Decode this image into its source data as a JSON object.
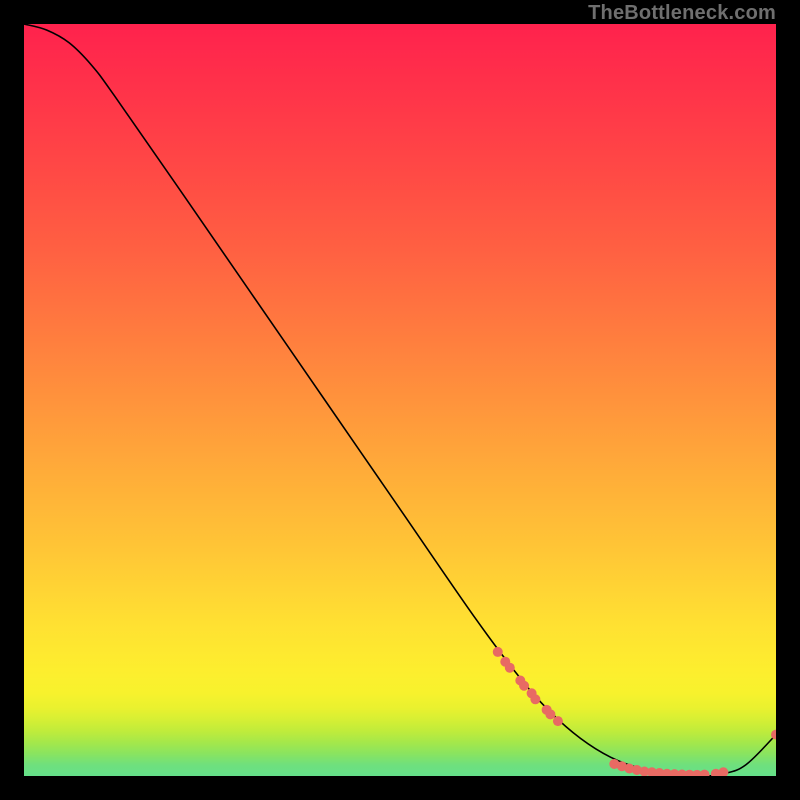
{
  "watermark": "TheBottleneck.com",
  "chart_data": {
    "type": "line",
    "title": "",
    "xlabel": "",
    "ylabel": "",
    "xlim": [
      0,
      100
    ],
    "ylim": [
      0,
      100
    ],
    "grid": false,
    "legend": false,
    "gradient_bands": [
      {
        "pos": 0.0,
        "color": "#65e08a"
      },
      {
        "pos": 0.015,
        "color": "#6fe07d"
      },
      {
        "pos": 0.03,
        "color": "#8ae45f"
      },
      {
        "pos": 0.045,
        "color": "#a5e84a"
      },
      {
        "pos": 0.06,
        "color": "#c0ec3b"
      },
      {
        "pos": 0.075,
        "color": "#d6ef34"
      },
      {
        "pos": 0.09,
        "color": "#e9f12f"
      },
      {
        "pos": 0.11,
        "color": "#f7f22d"
      },
      {
        "pos": 0.14,
        "color": "#fdee2e"
      },
      {
        "pos": 0.2,
        "color": "#ffe132"
      },
      {
        "pos": 0.3,
        "color": "#ffc636"
      },
      {
        "pos": 0.4,
        "color": "#ffad39"
      },
      {
        "pos": 0.5,
        "color": "#ff933c"
      },
      {
        "pos": 0.6,
        "color": "#ff793f"
      },
      {
        "pos": 0.7,
        "color": "#ff6042"
      },
      {
        "pos": 0.8,
        "color": "#ff4a45"
      },
      {
        "pos": 0.9,
        "color": "#ff3549"
      },
      {
        "pos": 1.0,
        "color": "#ff224d"
      }
    ],
    "series": [
      {
        "name": "bottleneck-curve",
        "x": [
          0,
          3,
          6,
          9,
          12,
          20,
          30,
          40,
          50,
          60,
          66,
          70,
          74,
          78,
          82,
          86,
          90,
          93,
          96,
          100
        ],
        "y": [
          100,
          99.2,
          97.5,
          94.5,
          90.5,
          79.0,
          64.5,
          50.0,
          35.5,
          21.0,
          13.0,
          8.5,
          5.0,
          2.5,
          1.0,
          0.3,
          0.0,
          0.3,
          1.5,
          5.5
        ]
      }
    ],
    "marker_clusters": [
      {
        "description": "upper-diagonal",
        "points_xy": [
          [
            63,
            16.5
          ],
          [
            64,
            15.2
          ],
          [
            64.6,
            14.4
          ],
          [
            66,
            12.7
          ],
          [
            66.5,
            12.0
          ],
          [
            67.5,
            11.0
          ],
          [
            68,
            10.2
          ],
          [
            69.5,
            8.8
          ],
          [
            70,
            8.2
          ],
          [
            71,
            7.3
          ]
        ]
      },
      {
        "description": "trough-group",
        "points_xy": [
          [
            78.5,
            1.6
          ],
          [
            79.5,
            1.3
          ],
          [
            80.5,
            1.0
          ],
          [
            81.5,
            0.8
          ],
          [
            82.5,
            0.6
          ],
          [
            83.5,
            0.5
          ],
          [
            84.5,
            0.4
          ],
          [
            85.5,
            0.3
          ],
          [
            86.5,
            0.25
          ],
          [
            87.5,
            0.2
          ],
          [
            88.5,
            0.17
          ],
          [
            89.5,
            0.15
          ],
          [
            90.5,
            0.18
          ],
          [
            92,
            0.3
          ],
          [
            93,
            0.5
          ]
        ]
      },
      {
        "description": "uptick-end",
        "points_xy": [
          [
            100,
            5.5
          ]
        ]
      }
    ],
    "marker_style": {
      "r": 5,
      "fill": "#e86a63",
      "stroke": "none"
    }
  }
}
